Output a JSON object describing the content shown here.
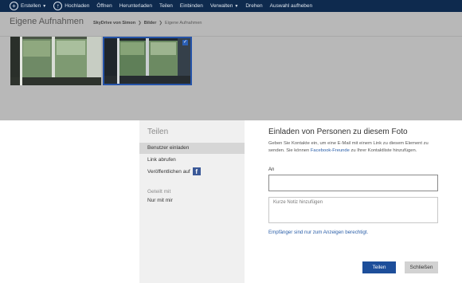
{
  "toolbar": {
    "items": [
      {
        "label": "Erstellen",
        "icon": "plus-icon",
        "caret": true
      },
      {
        "label": "Hochladen",
        "icon": "upload-icon",
        "caret": false
      },
      {
        "label": "Öffnen",
        "caret": false
      },
      {
        "label": "Herunterladen",
        "caret": false
      },
      {
        "label": "Teilen",
        "caret": false
      },
      {
        "label": "Einbinden",
        "caret": false
      },
      {
        "label": "Verwalten",
        "caret": true
      },
      {
        "label": "Drehen",
        "caret": false
      },
      {
        "label": "Auswahl aufheben",
        "caret": false
      }
    ]
  },
  "page": {
    "title": "Eigene Aufnahmen",
    "breadcrumb": [
      "SkyDrive von Simon",
      "Bilder",
      "Eigene Aufnahmen"
    ],
    "photos": [
      {
        "name": "photo-1",
        "selected": false
      },
      {
        "name": "photo-2",
        "selected": true
      }
    ]
  },
  "dialog": {
    "side_title": "Teilen",
    "menu": [
      "Benutzer einladen",
      "Link abrufen",
      "Veröffentlichen auf"
    ],
    "shared_with_label": "Geteilt mit",
    "shared_with_value": "Nur mit mir",
    "main_title": "Einladen von Personen zu diesem Foto",
    "desc_part1": "Geben Sie Kontakte ein, um eine E-Mail mit einem Link zu diesem Element zu senden. Sie können",
    "desc_link": "Facebook-Freunde",
    "desc_part2": "zu Ihrer Kontaktliste hinzufügen.",
    "to_label": "An",
    "to_value": "",
    "note_placeholder": "Kurze Notiz hinzufügen",
    "permission_link": "Empfänger sind nur zum Anzeigen berechtigt.",
    "share_button": "Teilen",
    "close_button": "Schließen"
  },
  "colors": {
    "toolbar_bg": "#0e2a4e",
    "accent": "#1d4e9a",
    "link": "#2a5ea8",
    "facebook": "#3b5998"
  }
}
